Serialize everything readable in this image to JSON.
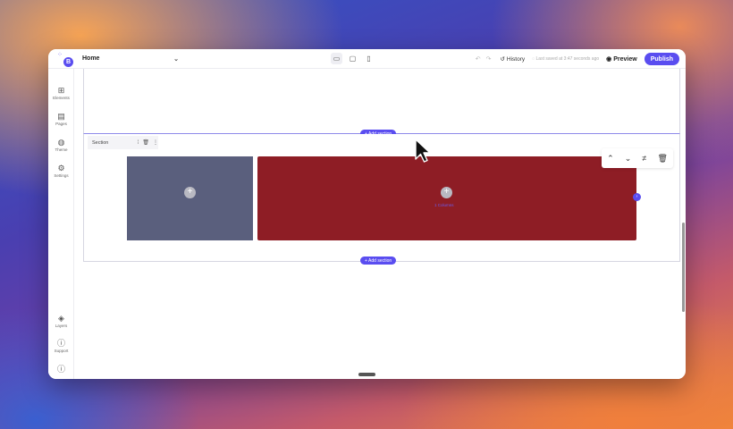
{
  "topbar": {
    "logo_badge": "B",
    "page_select_value": "Home",
    "undo_glyph": "↶ ↷",
    "history_label": "History",
    "saved_label": "Last saved at 3:47 seconds ago",
    "preview_label": "Preview",
    "publish_label": "Publish"
  },
  "sidebar": {
    "top_items": [
      {
        "label": "Elements",
        "icon": "grid-icon"
      },
      {
        "label": "Pages",
        "icon": "page-icon"
      },
      {
        "label": "Theme",
        "icon": "palette-icon"
      },
      {
        "label": "Settings",
        "icon": "gear-icon"
      }
    ],
    "bottom_items": [
      {
        "label": "Layers",
        "icon": "layers-icon"
      },
      {
        "label": "Support",
        "icon": "help-icon"
      },
      {
        "label": "",
        "icon": "info-icon"
      }
    ]
  },
  "canvas": {
    "add_section_label": "+ Add section",
    "section_label": "Section",
    "column_caption": "1 Columns"
  },
  "colors": {
    "accent": "#5a4df0",
    "column_a": "#5a5f7d",
    "column_b": "#8e1d25"
  }
}
